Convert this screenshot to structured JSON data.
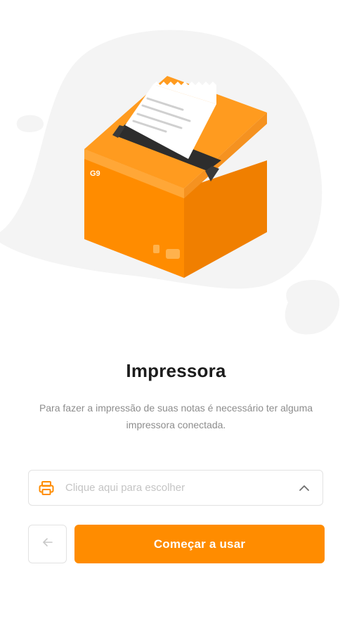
{
  "illustration": {
    "icon": "thermal-printer-illustration",
    "brand_mark": "G9"
  },
  "title": "Impressora",
  "description": "Para fazer a impressão de suas notas é necessário ter alguma impressora conectada.",
  "printer_select": {
    "icon": "printer-icon",
    "placeholder": "Clique aqui para escolher",
    "chevron_icon": "chevron-up-icon"
  },
  "buttons": {
    "back_icon": "arrow-left-icon",
    "start_label": "Começar a usar"
  },
  "colors": {
    "accent": "#ff8c00",
    "title": "#1c1c1c",
    "muted": "#8d8d8d",
    "placeholder": "#c4c4c4",
    "border": "#e2e2e2",
    "blob": "#f4f4f4"
  }
}
